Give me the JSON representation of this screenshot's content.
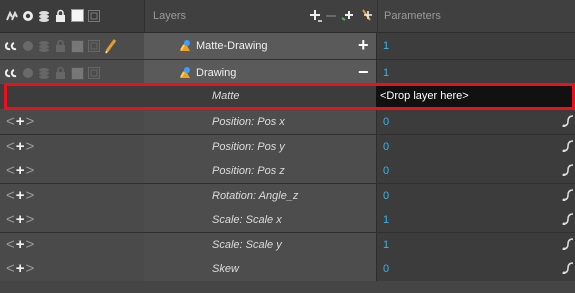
{
  "header": {
    "layers_title": "Layers",
    "parameters_title": "Parameters"
  },
  "layers": [
    {
      "name": "Matte-Drawing",
      "value": "1",
      "toggle": "+"
    },
    {
      "name": "Drawing",
      "value": "1",
      "toggle": "−"
    }
  ],
  "matte": {
    "label": "Matte",
    "value": "<Drop layer here>"
  },
  "params": [
    {
      "label": "Position: Pos x",
      "value": "0"
    },
    {
      "label": "Position: Pos y",
      "value": "0"
    },
    {
      "label": "Position: Pos z",
      "value": "0"
    },
    {
      "label": "Rotation: Angle_z",
      "value": "0"
    },
    {
      "label": "Scale: Scale x",
      "value": "1"
    },
    {
      "label": "Scale: Scale y",
      "value": "1"
    },
    {
      "label": "Skew",
      "value": "0"
    }
  ],
  "icons": {
    "header": [
      "onion-skin-icon",
      "visibility-icon",
      "layer-stack-icon",
      "lock-icon",
      "color-swatch-icon",
      "thumbnail-icon",
      "add-layer-icon",
      "add-peg-icon",
      "add-function-icon"
    ],
    "layer_row": [
      "onion-skin-icon",
      "visibility-dot-icon",
      "layer-stack-icon",
      "lock-icon",
      "color-swatch-icon",
      "thumbnail-icon",
      "pencil-icon",
      "drawing-layer-icon"
    ],
    "param_row": [
      "prev-keyframe-icon",
      "add-keyframe-icon",
      "next-keyframe-icon",
      "function-curve-icon"
    ]
  },
  "colors": {
    "value_text": "#36b6e8",
    "highlight_border": "#e8121d",
    "pencil": "#e0a030"
  }
}
